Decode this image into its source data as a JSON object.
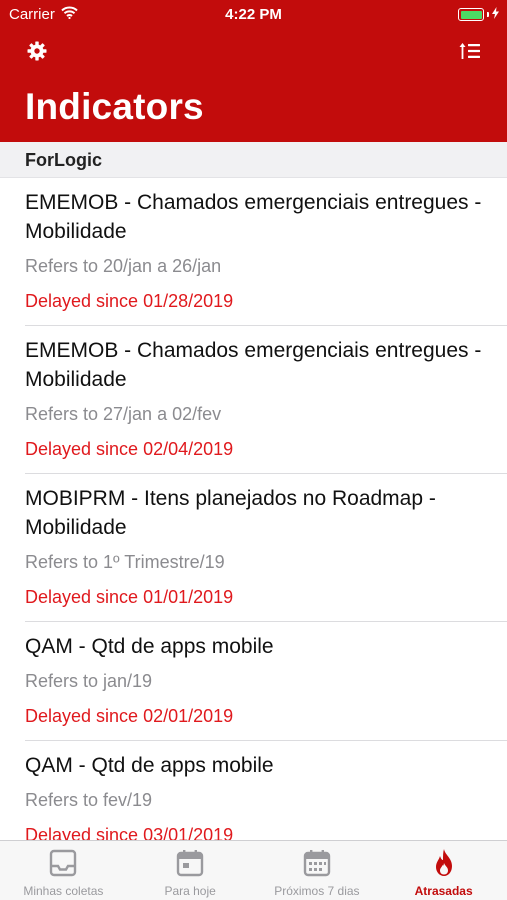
{
  "status_bar": {
    "carrier": "Carrier",
    "time": "4:22 PM"
  },
  "header": {
    "title": "Indicators"
  },
  "section": {
    "title": "ForLogic"
  },
  "items": [
    {
      "title": "EMEMOB -  Chamados emergenciais entregues - Mobilidade",
      "refers": "Refers to 20/jan a 26/jan",
      "delay": "Delayed since 01/28/2019"
    },
    {
      "title": "EMEMOB -  Chamados emergenciais entregues - Mobilidade",
      "refers": "Refers to 27/jan a 02/fev",
      "delay": "Delayed since 02/04/2019"
    },
    {
      "title": "MOBIPRM -  Itens planejados no Roadmap - Mobilidade",
      "refers": "Refers to 1º Trimestre/19",
      "delay": "Delayed since 01/01/2019"
    },
    {
      "title": "QAM -  Qtd de apps mobile",
      "refers": "Refers to jan/19",
      "delay": "Delayed since 02/01/2019"
    },
    {
      "title": "QAM -  Qtd de apps mobile",
      "refers": "Refers to fev/19",
      "delay": "Delayed since 03/01/2019"
    }
  ],
  "tabs": [
    {
      "label": "Minhas coletas",
      "icon": "inbox-icon"
    },
    {
      "label": "Para hoje",
      "icon": "calendar-today-icon"
    },
    {
      "label": "Próximos 7 dias",
      "icon": "calendar-week-icon"
    },
    {
      "label": "Atrasadas",
      "icon": "flame-icon",
      "active": true
    }
  ],
  "colors": {
    "brand": "#c20c0c",
    "delay": "#e0191d",
    "battery": "#4cd964"
  }
}
